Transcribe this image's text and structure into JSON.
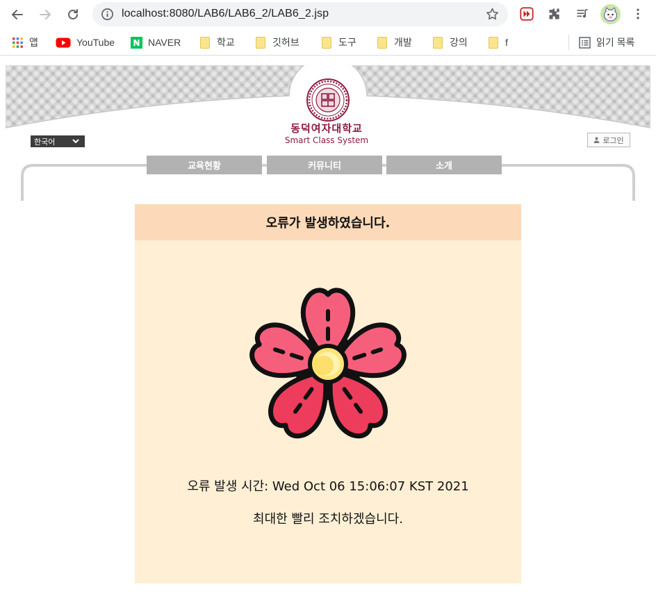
{
  "browser": {
    "url": "localhost:8080/LAB6/LAB6_2/LAB6_2.jsp",
    "bookmarks": [
      {
        "label": "앱",
        "icon": "apps-grid-icon"
      },
      {
        "label": "YouTube",
        "icon": "youtube-icon"
      },
      {
        "label": "NAVER",
        "icon": "naver-icon"
      },
      {
        "label": "학교",
        "icon": "folder-icon"
      },
      {
        "label": "깃허브",
        "icon": "folder-icon"
      },
      {
        "label": "도구",
        "icon": "folder-icon"
      },
      {
        "label": "개발",
        "icon": "folder-icon"
      },
      {
        "label": "강의",
        "icon": "folder-icon"
      },
      {
        "label": "f",
        "icon": "folder-icon"
      }
    ],
    "reading_list": "읽기 목록"
  },
  "site": {
    "language": "한국어",
    "university": "동덕여자대학교",
    "system": "Smart Class System",
    "login": "로그인",
    "menu": [
      "교육현황",
      "커뮤니티",
      "소개"
    ]
  },
  "error": {
    "title": "오류가 발생하였습니다.",
    "time": "오류 발생 시간: Wed Oct 06 15:06:07 KST 2021",
    "message": "최대한 빨리 조치하겠습니다."
  },
  "colors": {
    "card_bg": "#feefd5",
    "card_header": "#fcdab9",
    "brand": "#8d1b3d",
    "petal": "#f65f7c",
    "petal_dark": "#ee3d5c",
    "center": "#fde47a"
  }
}
